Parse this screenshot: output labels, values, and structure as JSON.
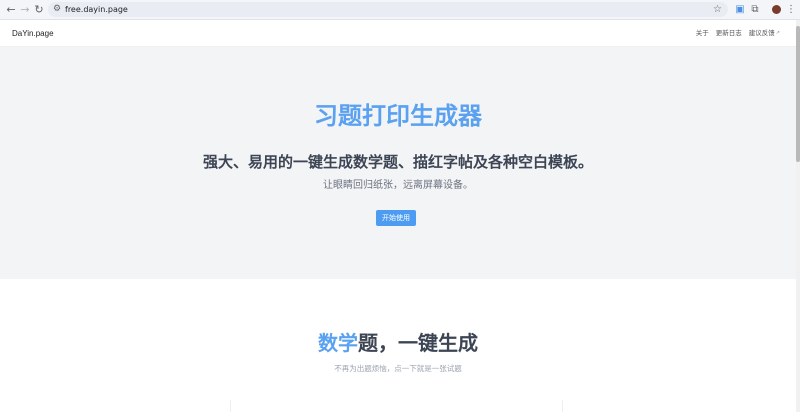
{
  "browser": {
    "url": "free.dayin.page",
    "icons": {
      "back": "arrow-left-icon",
      "forward": "arrow-right-icon",
      "reload": "reload-icon",
      "site_info": "tune-icon",
      "bookmark": "star-icon",
      "extension": "extension-icon",
      "puzzle": "puzzle-icon",
      "menu": "more-vert-icon"
    }
  },
  "site": {
    "logo": "DaYin.page",
    "nav": [
      {
        "label": "关于"
      },
      {
        "label": "更新日志"
      },
      {
        "label": "建议反馈"
      }
    ]
  },
  "hero": {
    "title": "习题打印生成器",
    "subtitle": "强大、易用的一键生成数学题、描红字帖及各种空白模板。",
    "description": "让眼睛回归纸张，远离屏幕设备。",
    "cta": "开始使用"
  },
  "section": {
    "title_accent": "数学",
    "title_rest": "题，一键生成",
    "description": "不再为出题烦恼，点一下就是一张试题"
  },
  "colors": {
    "accent": "#5aa1f0",
    "button": "#4d9cf2",
    "hero_bg": "#f3f4f6",
    "heading": "#3d4555"
  }
}
